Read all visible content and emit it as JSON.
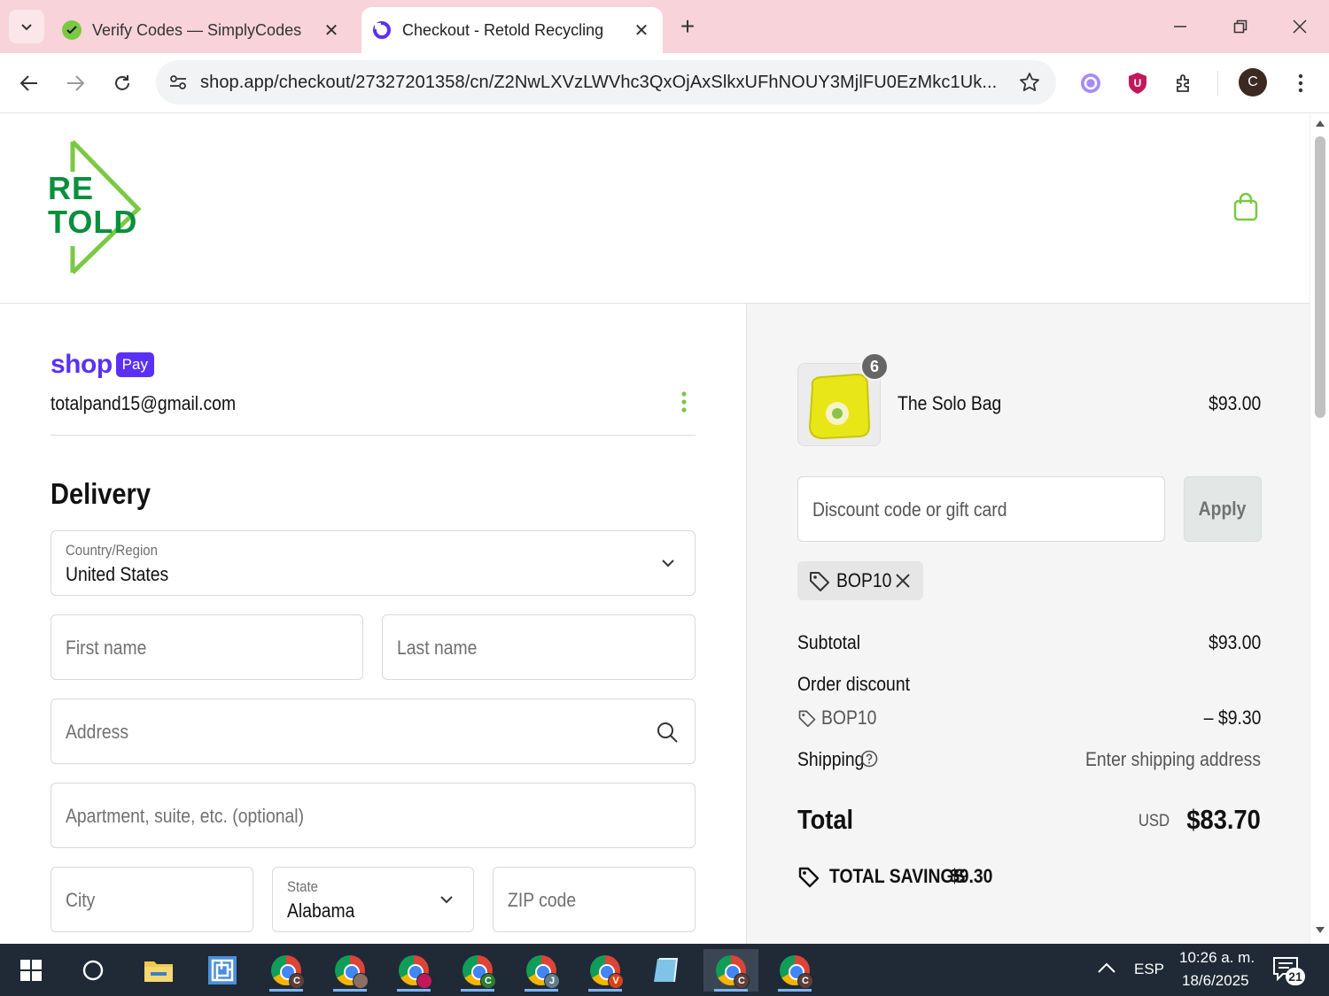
{
  "browser": {
    "tabs": [
      {
        "title": "Verify Codes — SimplyCodes",
        "active": false
      },
      {
        "title": "Checkout - Retold Recycling",
        "active": true
      }
    ],
    "url": "shop.app/checkout/27327201358/cn/Z2NwLXVzLWVhc3QxOjAxSlkxUFhNOUY3MjlFU0EzMkc1Uk...",
    "profile_initial": "C"
  },
  "logo": {
    "line1": "RE",
    "line2": "TOLD",
    "color": "#0a8f3c",
    "accent": "#7ac943"
  },
  "shop_pay": {
    "brand": "shop",
    "badge": "Pay",
    "color": "#5a31f4"
  },
  "account": {
    "email": "totalpand15@gmail.com"
  },
  "delivery": {
    "title": "Delivery",
    "country": {
      "label": "Country/Region",
      "value": "United States"
    },
    "first_name": {
      "placeholder": "First name"
    },
    "last_name": {
      "placeholder": "Last name"
    },
    "address": {
      "placeholder": "Address"
    },
    "apartment": {
      "placeholder": "Apartment, suite, etc. (optional)"
    },
    "city": {
      "placeholder": "City"
    },
    "state": {
      "label": "State",
      "value": "Alabama"
    },
    "zip": {
      "placeholder": "ZIP code"
    }
  },
  "summary": {
    "item": {
      "name": "The Solo Bag",
      "price": "$93.00",
      "quantity": "6"
    },
    "discount_input": {
      "placeholder": "Discount code or gift card"
    },
    "apply_label": "Apply",
    "applied_code": "BOP10",
    "subtotal_label": "Subtotal",
    "subtotal_value": "$93.00",
    "order_discount_label": "Order discount",
    "discount_code": "BOP10",
    "discount_value": "– $9.30",
    "shipping_label": "Shipping",
    "shipping_value": "Enter shipping address",
    "total_label": "Total",
    "currency": "USD",
    "total_value": "$83.70",
    "savings_label": "TOTAL SAVINGS",
    "savings_value": "$9.30"
  },
  "taskbar": {
    "language": "ESP",
    "time": "10:26 a. m.",
    "date": "18/6/2025",
    "notifications": "21",
    "chrome_badges": [
      {
        "letter": "C",
        "color": "#5d4037"
      },
      {
        "letter": "",
        "color": "#8d6e63"
      },
      {
        "letter": "",
        "color": "#c2185b"
      },
      {
        "letter": "C",
        "color": "#2e7d32"
      },
      {
        "letter": "J",
        "color": "#607d8b"
      },
      {
        "letter": "V",
        "color": "#d84315"
      },
      {
        "letter": "C",
        "color": "#5d4037"
      },
      {
        "letter": "C",
        "color": "#5d4037"
      }
    ]
  }
}
